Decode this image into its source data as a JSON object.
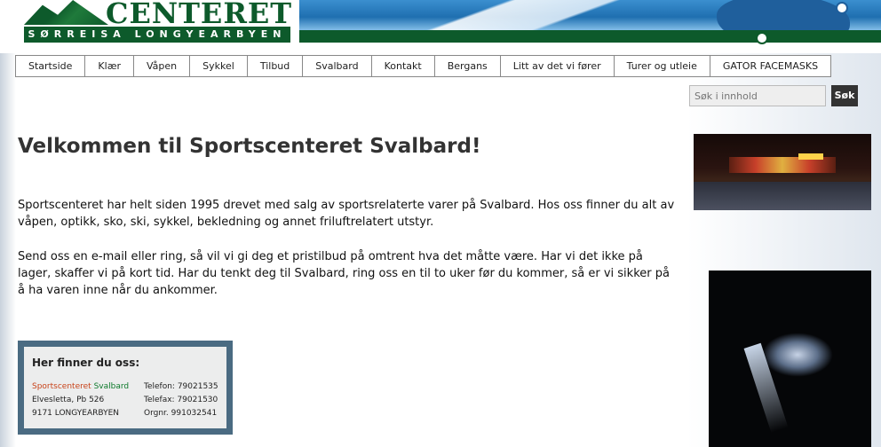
{
  "header": {
    "logo_title": "CENTERET",
    "logo_subtitle": "SØRREISA LONGYEARBYEN"
  },
  "nav": {
    "items": [
      "Startside",
      "Klær",
      "Våpen",
      "Sykkel",
      "Tilbud",
      "Svalbard",
      "Kontakt",
      "Bergans",
      "Litt av det vi fører",
      "Turer og utleie",
      "GATOR FACEMASKS"
    ]
  },
  "search": {
    "placeholder": "Søk i innhold",
    "button_label": "Søk"
  },
  "main": {
    "title": "Velkommen til Sportscenteret Svalbard!",
    "paragraphs": [
      "Sportscenteret har helt siden 1995 drevet med salg av sportsrelaterte varer på Svalbard. Hos oss finner du alt av våpen, optikk, sko, ski, sykkel, bekledning og annet friluftrelatert utstyr.",
      "Send oss en e-mail eller ring, så vil vi gi deg et pristilbud på omtrent hva det måtte være. Har vi det ikke på lager, skaffer vi på kort tid. Har du tenkt deg til Svalbard, ring oss en til to uker før du kommer, så er vi sikker på å ha varen inne når du ankommer."
    ]
  },
  "contact": {
    "heading": "Her finner du oss:",
    "name_part1": "Sportscenteret",
    "name_part2": "Svalbard",
    "address1": "Elvesletta, Pb 526",
    "address2": "9171 LONGYEARBYEN",
    "telefon": "Telefon: 79021535",
    "telefax": "Telefax: 79021530",
    "orgnr": "Orgnr.  991032541"
  },
  "colors": {
    "brand_green": "#0d5a2b",
    "brand_red": "#c8431a",
    "contact_border": "#4a6b82"
  }
}
